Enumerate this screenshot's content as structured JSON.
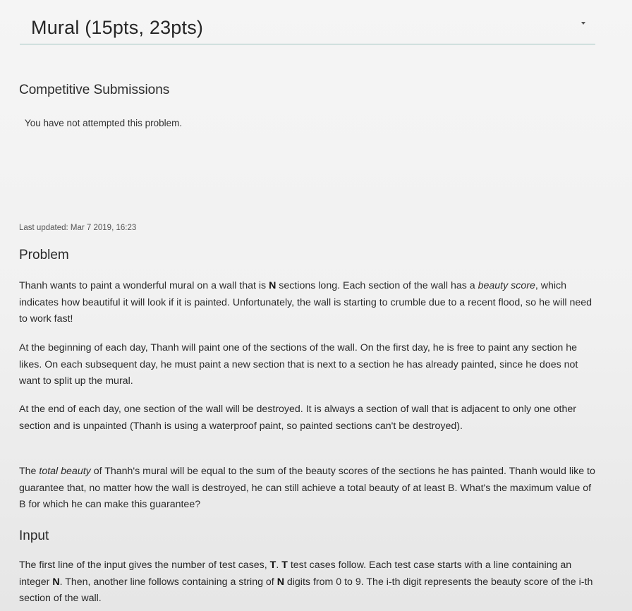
{
  "header": {
    "title": "Mural (15pts, 23pts)"
  },
  "competitive": {
    "heading": "Competitive Submissions",
    "status": "You have not attempted this problem."
  },
  "last_updated": "Last updated: Mar 7 2019, 16:23",
  "problem": {
    "heading": "Problem",
    "p1": {
      "t1": "Thanh wants to paint a wonderful mural on a wall that is ",
      "N": "N",
      "t2": " sections long. Each section of the wall has a ",
      "em": "beauty score",
      "t3": ", which indicates how beautiful it will look if it is painted. Unfortunately, the wall is starting to crumble due to a recent flood, so he will need to work fast!"
    },
    "p2": "At the beginning of each day, Thanh will paint one of the sections of the wall. On the first day, he is free to paint any section he likes. On each subsequent day, he must paint a new section that is next to a section he has already painted, since he does not want to split up the mural.",
    "p3": "At the end of each day, one section of the wall will be destroyed. It is always a section of wall that is adjacent to only one other section and is unpainted (Thanh is using a waterproof paint, so painted sections can't be destroyed).",
    "p4": {
      "t1": "The ",
      "em": "total beauty",
      "t2": " of Thanh's mural will be equal to the sum of the beauty scores of the sections he has painted. Thanh would like to guarantee that, no matter how the wall is destroyed, he can still achieve a total beauty of at least B. What's the maximum value of B for which he can make this guarantee?"
    }
  },
  "input": {
    "heading": "Input",
    "p1": {
      "t1": "The first line of the input gives the number of test cases, ",
      "T1": "T",
      "t2": ". ",
      "T2": "T",
      "t3": " test cases follow. Each test case starts with a line containing an integer ",
      "N1": "N",
      "t4": ". Then, another line follows containing a string of ",
      "N2": "N",
      "t5": " digits from 0 to 9. The i-th digit represents the beauty score of the i-th section of the wall."
    }
  }
}
